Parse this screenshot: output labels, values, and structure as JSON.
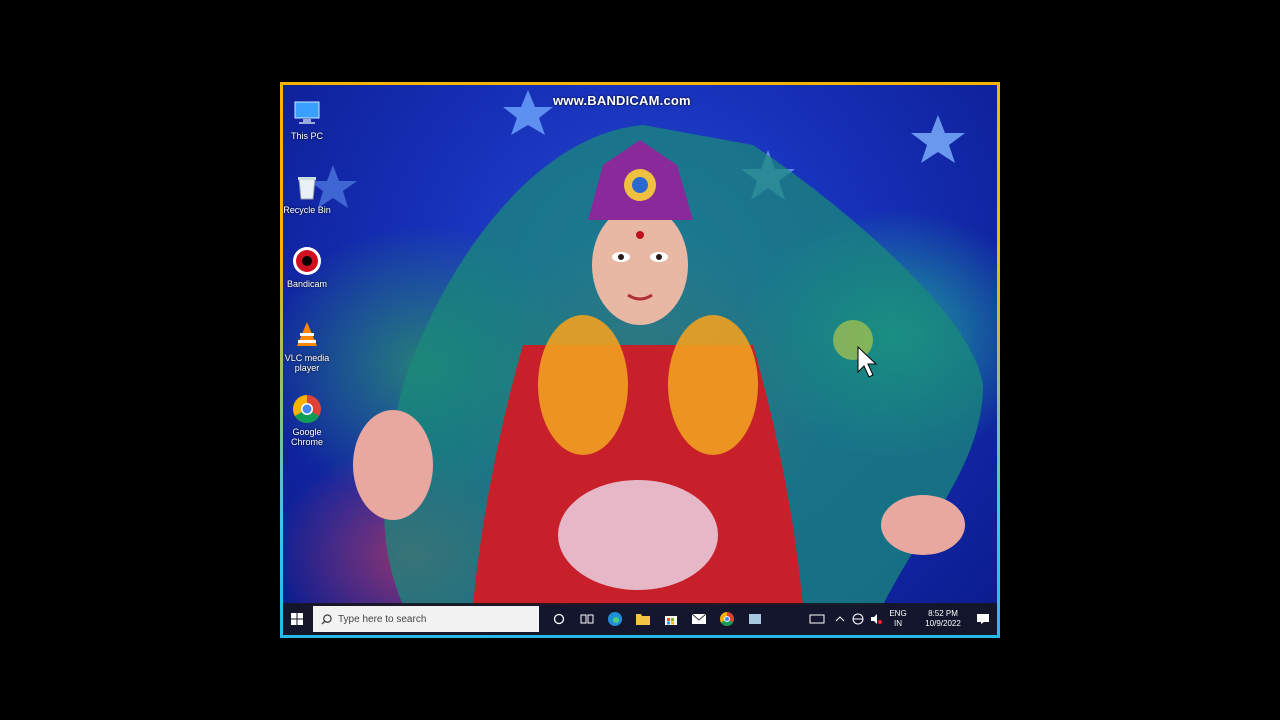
{
  "watermark": "www.BANDICAM.com",
  "desktop": {
    "icons": [
      {
        "label": "This PC",
        "icon": "this-pc-icon"
      },
      {
        "label": "Recycle Bin",
        "icon": "recycle-bin-icon"
      },
      {
        "label": "Bandicam",
        "icon": "bandicam-icon"
      },
      {
        "label": "VLC media player",
        "icon": "vlc-icon"
      },
      {
        "label": "Google Chrome",
        "icon": "chrome-icon"
      }
    ]
  },
  "taskbar": {
    "search_placeholder": "Type here to search",
    "apps": [
      "cortana-icon",
      "task-view-icon",
      "edge-icon",
      "file-explorer-icon",
      "store-icon",
      "mail-icon",
      "chrome-icon",
      "app-icon"
    ],
    "tray": {
      "language_top": "ENG",
      "language_bottom": "IN",
      "time": "8:52 PM",
      "date": "10/9/2022"
    }
  },
  "colors": {
    "frame_top": "#f5b400",
    "frame_bottom": "#25b8ea",
    "taskbar": "#14141e"
  }
}
